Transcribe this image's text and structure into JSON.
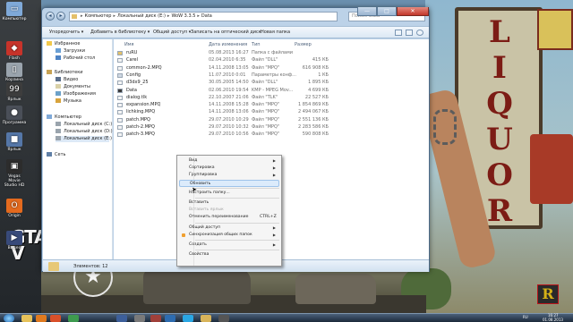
{
  "desktop": {
    "icons": [
      {
        "label": "Компьютер",
        "color": "#7fa9d8",
        "glyph": "▭"
      },
      {
        "label": "Flash",
        "color": "#c7332a",
        "glyph": "◆"
      },
      {
        "label": "Корзина",
        "color": "#9aa4ad",
        "glyph": "▯"
      },
      {
        "label": "Ярлык",
        "color": "#3d3d3d",
        "glyph": "99"
      },
      {
        "label": "Программа",
        "color": "#4a4f58",
        "glyph": "●"
      },
      {
        "label": "Ярлык",
        "color": "#5577a8",
        "glyph": "■"
      },
      {
        "label": "Vegas Movie Studio HD",
        "color": "#2c2c2c",
        "glyph": "▣"
      },
      {
        "label": "Origin",
        "color": "#e46a1e",
        "glyph": "O"
      },
      {
        "label": "Видео",
        "color": "#384a7a",
        "glyph": "▶"
      }
    ],
    "wallpaper": {
      "sign_letters": "L\nI\nQ\nU\nO\nR",
      "gta_text": "GTA\nV",
      "block_letter": "R"
    }
  },
  "window": {
    "address": {
      "parts": [
        "Компьютер",
        "Локальный диск (E:)",
        "WoW 3.3.5",
        "Data"
      ],
      "separator": "▸"
    },
    "search_placeholder": "Поиск: Data",
    "controls": {
      "minimize": "—",
      "maximize": "□",
      "close": "✕"
    },
    "toolbar": {
      "organize": "Упорядочить ▾",
      "add_to_library": "Добавить в библиотеку ▾",
      "share": "Общий доступ ▾",
      "burn": "Записать на оптический диск",
      "new_folder": "Новая папка"
    },
    "nav": {
      "favorites_header": "Избранное",
      "favorites": [
        "Загрузки",
        "Рабочий стол"
      ],
      "libraries_header": "Библиотеки",
      "libraries": [
        "Видео",
        "Документы",
        "Изображения",
        "Музыка"
      ],
      "computer_header": "Компьютер",
      "drives": [
        "Локальный диск (C:)",
        "Локальный диск (D:)",
        "Локальный диск (E:)"
      ],
      "network": "Сеть"
    },
    "columns": {
      "name": "Имя",
      "date": "Дата изменения",
      "type": "Тип",
      "size": "Размер"
    },
    "files": [
      {
        "name": "ruRU",
        "date": "05.08.2013 16:27",
        "type": "Папка с файлами",
        "size": "",
        "icon": "folder"
      },
      {
        "name": "Carel",
        "date": "02.04.2010 6:35",
        "type": "Файл \"DLL\"",
        "size": "415 КБ",
        "icon": "file"
      },
      {
        "name": "common-2.MPQ",
        "date": "14.11.2008 13:05",
        "type": "Файл \"MPQ\"",
        "size": "616 908 КБ",
        "icon": "file"
      },
      {
        "name": "Config",
        "date": "11.07.2010 0:01",
        "type": "Параметры конф...",
        "size": "1 КБ",
        "icon": "config"
      },
      {
        "name": "d3dx9_25",
        "date": "30.05.2005 14:50",
        "type": "Файл \"DLL\"",
        "size": "1 895 КБ",
        "icon": "file"
      },
      {
        "name": "Data",
        "date": "02.06.2010 19:54",
        "type": "KMP - MPEG Mov...",
        "size": "4 699 КБ",
        "icon": "video"
      },
      {
        "name": "dialog.tlk",
        "date": "22.10.2007 21:06",
        "type": "Файл \"TLK\"",
        "size": "22 527 КБ",
        "icon": "file"
      },
      {
        "name": "expansion.MPQ",
        "date": "14.11.2008 15:28",
        "type": "Файл \"MPQ\"",
        "size": "1 854 869 КБ",
        "icon": "file"
      },
      {
        "name": "lichking.MPQ",
        "date": "14.11.2008 13:06",
        "type": "Файл \"MPQ\"",
        "size": "2 494 067 КБ",
        "icon": "file"
      },
      {
        "name": "patch.MPQ",
        "date": "29.07.2010 10:29",
        "type": "Файл \"MPQ\"",
        "size": "2 551 136 КБ",
        "icon": "file"
      },
      {
        "name": "patch-2.MPQ",
        "date": "29.07.2010 10:32",
        "type": "Файл \"MPQ\"",
        "size": "2 283 586 КБ",
        "icon": "file"
      },
      {
        "name": "patch-3.MPQ",
        "date": "29.07.2010 10:56",
        "type": "Файл \"MPQ\"",
        "size": "590 808 КБ",
        "icon": "file"
      }
    ],
    "status": "Элементов: 12"
  },
  "context_menu": {
    "items": [
      {
        "label": "Вид",
        "submenu": true
      },
      {
        "label": "Сортировка",
        "submenu": true
      },
      {
        "label": "Группировка",
        "submenu": true
      },
      {
        "label": "Обновить",
        "highlighted": true
      },
      {
        "sep": true
      },
      {
        "label": "Настроить папку..."
      },
      {
        "sep": true
      },
      {
        "label": "Вставить"
      },
      {
        "label": "Вставить ярлык",
        "disabled": true
      },
      {
        "label": "Отменить переименование",
        "shortcut": "CTRL+Z"
      },
      {
        "sep": true
      },
      {
        "label": "Общий доступ",
        "submenu": true
      },
      {
        "label": "Синхронизация общих папок",
        "submenu": true,
        "icon": true
      },
      {
        "sep": true
      },
      {
        "label": "Создать",
        "submenu": true
      },
      {
        "sep": true
      },
      {
        "label": "Свойства"
      }
    ]
  },
  "taskbar": {
    "apps": [
      {
        "name": "explorer",
        "color": "#e6c25a"
      },
      {
        "name": "media",
        "color": "#e07a1f"
      },
      {
        "name": "browser",
        "color": "#d9502a"
      },
      {
        "name": "chrome",
        "color": "#3e9b4f"
      },
      {
        "name": "wow",
        "color": "#3d5f9a"
      },
      {
        "name": "app",
        "color": "#7a7a7a"
      },
      {
        "name": "vegas",
        "color": "#a0403a"
      },
      {
        "name": "photoshop",
        "color": "#2d6cb0"
      },
      {
        "name": "skype",
        "color": "#2aa7e4"
      },
      {
        "name": "folder",
        "color": "#d8b45a"
      },
      {
        "name": "program",
        "color": "#555"
      }
    ],
    "lang": "RU",
    "time": "16:27",
    "date": "01.08.2013"
  }
}
